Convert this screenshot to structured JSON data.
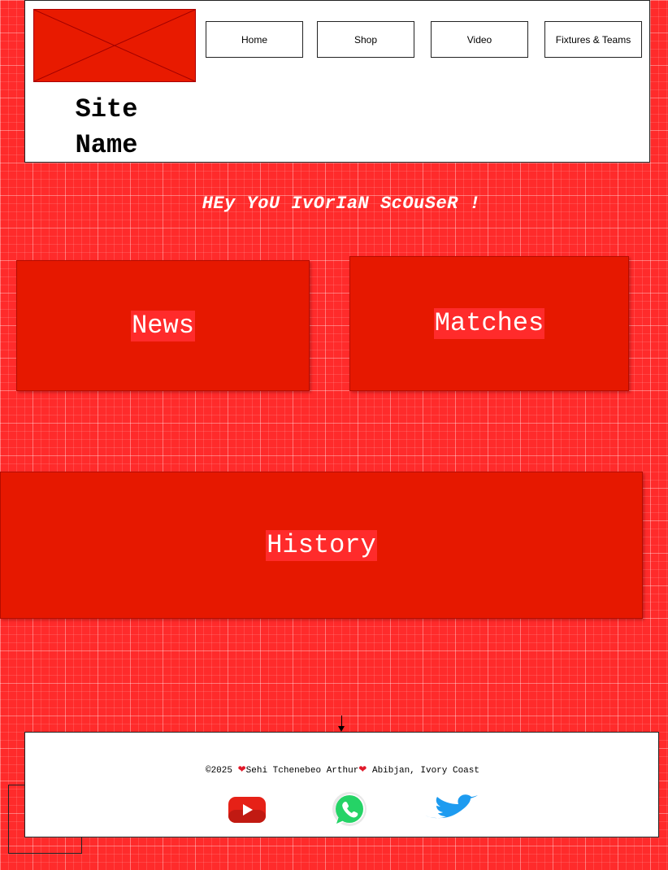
{
  "header": {
    "site_name_line1": "Site",
    "site_name_line2": "Name",
    "logo": {
      "icon": "image-placeholder-icon",
      "color": "#e81a00"
    },
    "nav": [
      {
        "label": "Home"
      },
      {
        "label": "Shop"
      },
      {
        "label": "Video"
      },
      {
        "label": "Fixtures & Teams"
      }
    ]
  },
  "greeting": "HEy YoU IvOrIaN ScOuSeR !",
  "cards": {
    "news": "News",
    "matches": "Matches",
    "history": "History"
  },
  "footer": {
    "year": "©2025",
    "author": "Sehi Tchenebeo Arthur",
    "location": "Abibjan, Ivory Coast",
    "socials": [
      {
        "icon": "youtube-icon",
        "color": "#ff0000"
      },
      {
        "icon": "whatsapp-icon",
        "color": "#25d366"
      },
      {
        "icon": "twitter-icon",
        "color": "#1da1f2"
      }
    ]
  },
  "colors": {
    "background": "#ff2b2b",
    "card": "#e61800",
    "header_bg": "#ffffff"
  }
}
